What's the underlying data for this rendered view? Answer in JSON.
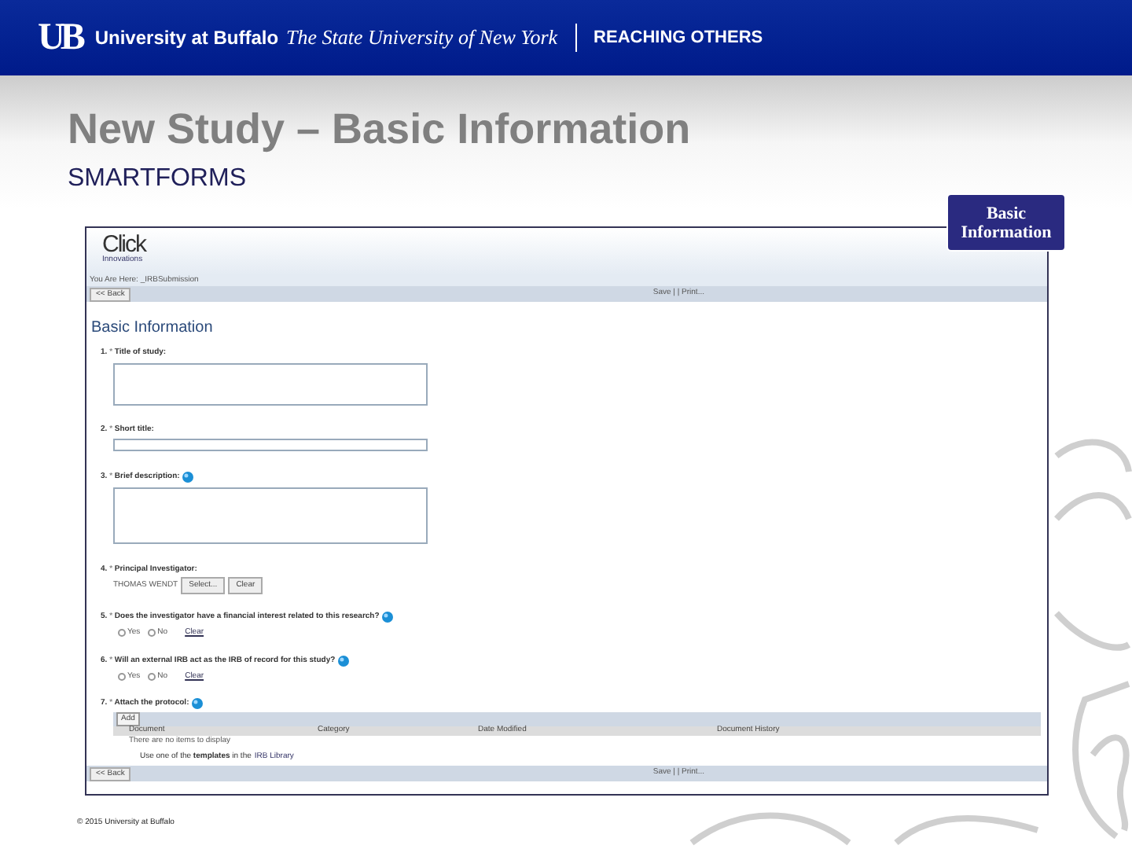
{
  "header": {
    "logo": "UB",
    "university": "University at Buffalo",
    "subtitle": "The State University of New York",
    "tagline": "REACHING OTHERS"
  },
  "title": "New Study – Basic Information",
  "subtitle": "SMARTFORMS",
  "badge": "Basic Information",
  "app": {
    "logo": "Click",
    "logo_sub": "Innovations",
    "breadcrumb": "You Are Here: _IRBSubmission",
    "toolbar": {
      "back": "<< Back",
      "actions": "Save | | Print..."
    },
    "heading": "Basic Information",
    "questions": [
      {
        "kind": "textarea",
        "number": "1.",
        "required": "*",
        "label": "Title of study:",
        "help": false
      },
      {
        "kind": "text",
        "number": "2.",
        "required": "*",
        "label": "Short title:",
        "help": false
      },
      {
        "kind": "textarea",
        "number": "3.",
        "required": "*",
        "label": "Brief description:",
        "help": true
      },
      {
        "kind": "person",
        "number": "4.",
        "required": "*",
        "label": "Principal Investigator:",
        "help": false,
        "value": "THOMAS WENDT",
        "buttons": [
          "Select...",
          "Clear"
        ]
      },
      {
        "kind": "radio",
        "number": "5.",
        "required": "*",
        "label": "Does the investigator have a financial interest related to this research?",
        "help": true,
        "options": [
          {
            "label": "Yes",
            "selected": false
          },
          {
            "label": "No",
            "selected": false
          }
        ],
        "clear": "Clear"
      },
      {
        "kind": "radio",
        "number": "6.",
        "required": "*",
        "label": "Will an external IRB act as the IRB of record for this study?",
        "help": true,
        "options": [
          {
            "label": "Yes",
            "selected": false
          },
          {
            "label": "No",
            "selected": false
          }
        ],
        "clear": "Clear"
      },
      {
        "kind": "attachments",
        "number": "7.",
        "required": "*",
        "label": "Attach the protocol:",
        "help": true,
        "add": "Add",
        "columns": [
          "Document",
          "Category",
          "Date Modified",
          "Document History"
        ],
        "empty": "There are no items to display",
        "note": "Use one of the **templates** in the",
        "link": "IRB Library"
      }
    ],
    "footer_toolbar": {
      "back": "<< Back",
      "actions": "Save | | Print..."
    }
  },
  "copyright": "© 2015 University at Buffalo"
}
